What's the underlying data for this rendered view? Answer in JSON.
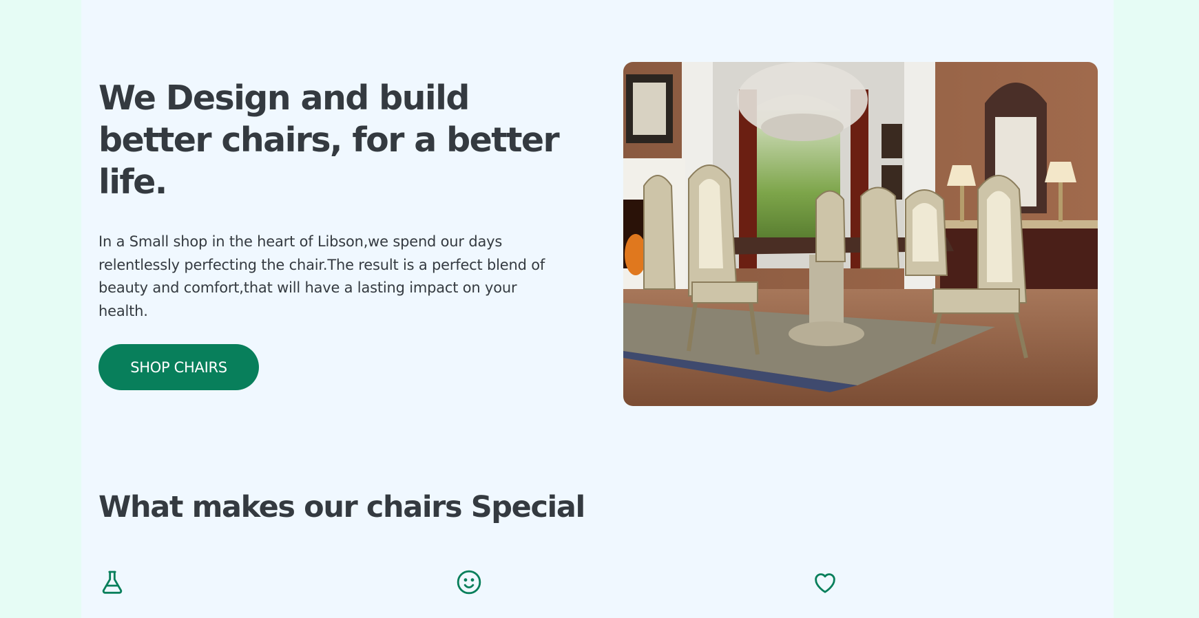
{
  "hero": {
    "title": "We Design and build better chairs, for a better life.",
    "text": "In a Small shop in the heart of Libson,we spend our days relentlessly perfecting the chair.The result is a perfect blend of beauty and comfort,that will have a lasting impact on your health.",
    "button_label": "SHOP CHAIRS",
    "image_icon": "ornate-dining-room-photo"
  },
  "features": {
    "title": "What makes our chairs Special",
    "icons": [
      "flask-icon",
      "smile-icon",
      "heart-icon"
    ]
  },
  "colors": {
    "page_bg": "#e6fcf5",
    "container_bg": "#f0f8ff",
    "text": "#343a40",
    "accent": "#087f5b"
  }
}
